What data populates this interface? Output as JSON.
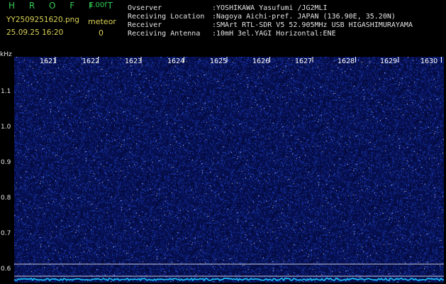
{
  "header": {
    "app_title": "H R O F F T",
    "version": "1.00f",
    "filename": "YY2509251620.png",
    "datetime": "25.09.25 16:20",
    "meteor_label": "meteor",
    "meteor_count": "0",
    "info": [
      {
        "key": "Ovserver",
        "value": ":YOSHIKAWA Yasufumi /JG2MLI"
      },
      {
        "key": "Receiving Location",
        "value": ":Nagoya Aichi-pref. JAPAN (136.90E, 35.20N)"
      },
      {
        "key": "Receiver",
        "value": ":SMArt RTL-SDR V5 52.905MHz USB HIGASHIMURAYAMA"
      },
      {
        "key": "Receiving Antenna",
        "value": ":10mH 3el.YAGI Horizontal:ENE"
      }
    ]
  },
  "axes": {
    "y_unit": "kHz",
    "y_ticks": [
      "1.1",
      "1.0",
      "0.9",
      "0.8",
      "0.7",
      "0.6"
    ],
    "x_ticks": [
      "1621",
      "1622",
      "1623",
      "1624",
      "1625",
      "1626",
      "1627",
      "1628",
      "1629",
      "1630"
    ]
  },
  "colors": {
    "background": "#000000",
    "noise_base": "#0a0a55",
    "noise_dot": "#2a3cff",
    "reference_line": "#c8c8d8",
    "level_trace": "#18c8ff",
    "title_green": "#33cc55",
    "label_yellow": "#d8d054"
  }
}
